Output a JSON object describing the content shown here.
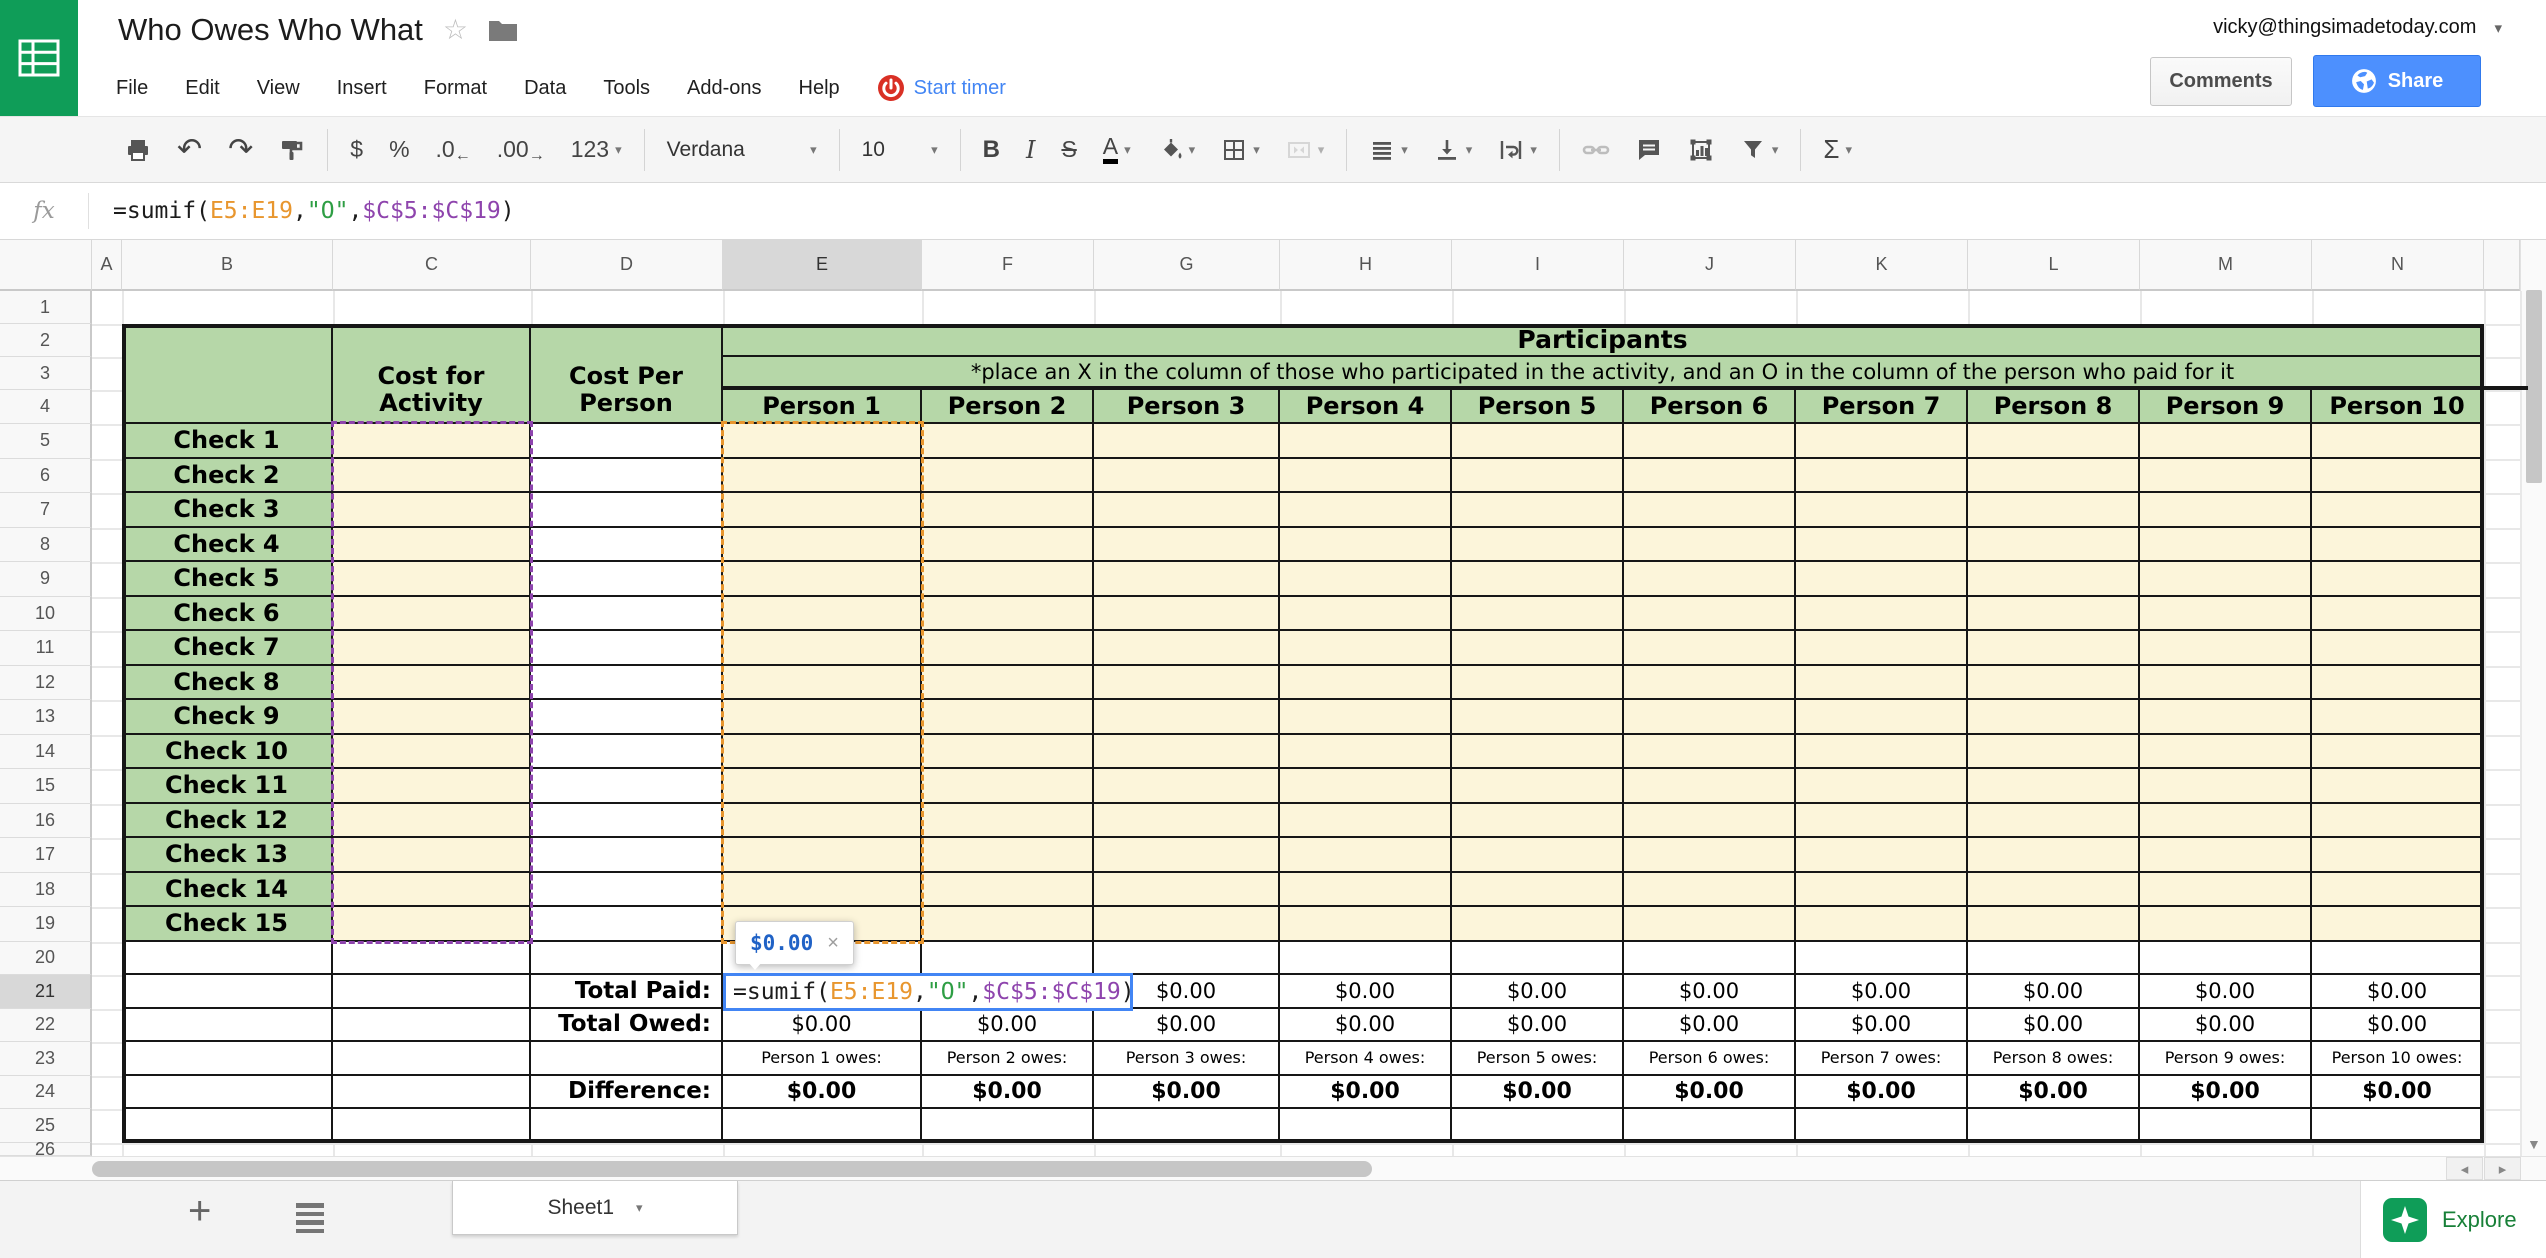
{
  "titlebar": {
    "title": "Who Owes Who What",
    "account_email": "vicky@thingsimadetoday.com",
    "comments_label": "Comments",
    "share_label": "Share"
  },
  "menubar": {
    "items": [
      "File",
      "Edit",
      "View",
      "Insert",
      "Format",
      "Data",
      "Tools",
      "Add-ons",
      "Help"
    ],
    "timer_label": "Start timer"
  },
  "toolbar": {
    "currency": "$",
    "percent": "%",
    "decrease_decimal": ".0",
    "increase_decimal": ".00",
    "more_formats": "123",
    "font_name": "Verdana",
    "font_size": "10",
    "bold": "B",
    "italic": "I",
    "strikethrough": "S",
    "text_color": "A",
    "functions": "Σ"
  },
  "formula_bar": {
    "fx_label": "fx",
    "formula": [
      {
        "text": "=sumif(",
        "color": "#1c1c1c"
      },
      {
        "text": "E5:E19",
        "color": "#e8962e"
      },
      {
        "text": ",",
        "color": "#1c1c1c"
      },
      {
        "text": "\"O\"",
        "color": "#2e9e44"
      },
      {
        "text": ",",
        "color": "#1c1c1c"
      },
      {
        "text": "$C$5:$C$19",
        "color": "#8e44ad"
      },
      {
        "text": ")",
        "color": "#1c1c1c"
      }
    ]
  },
  "sheet": {
    "column_letters": [
      "A",
      "B",
      "C",
      "D",
      "E",
      "F",
      "G",
      "H",
      "I",
      "J",
      "K",
      "L",
      "M",
      "N"
    ],
    "row_numbers": [
      "1",
      "2",
      "3",
      "4",
      "5",
      "6",
      "7",
      "8",
      "9",
      "10",
      "11",
      "12",
      "13",
      "14",
      "15",
      "16",
      "17",
      "18",
      "19",
      "20",
      "21",
      "22",
      "23",
      "24",
      "25",
      "26"
    ],
    "cost_for_activity": "Cost for Activity",
    "cost_per_person": "Cost Per Person",
    "participants_title": "Participants",
    "participants_note": "*place an X in the column of those who participated in the activity, and an O in the column of the person who paid for it",
    "person_headers": [
      "Person 1",
      "Person 2",
      "Person 3",
      "Person 4",
      "Person 5",
      "Person 6",
      "Person 7",
      "Person 8",
      "Person 9",
      "Person 10"
    ],
    "check_labels": [
      "Check 1",
      "Check 2",
      "Check 3",
      "Check 4",
      "Check 5",
      "Check 6",
      "Check 7",
      "Check 8",
      "Check 9",
      "Check 10",
      "Check 11",
      "Check 12",
      "Check 13",
      "Check 14",
      "Check 15"
    ],
    "total_paid_label": "Total Paid:",
    "total_owed_label": "Total Owed:",
    "difference_label": "Difference:",
    "total_paid_values": [
      "$0.00",
      "$0.00",
      "$0.00",
      "$0.00",
      "$0.00",
      "$0.00",
      "$0.00",
      "$0.00"
    ],
    "total_owed_values": [
      "$0.00",
      "$0.00",
      "$0.00",
      "$0.00",
      "$0.00",
      "$0.00",
      "$0.00",
      "$0.00",
      "$0.00",
      "$0.00"
    ],
    "owes_labels": [
      "Person 1 owes:",
      "Person 2 owes:",
      "Person 3 owes:",
      "Person 4 owes:",
      "Person 5 owes:",
      "Person 6 owes:",
      "Person 7 owes:",
      "Person 8 owes:",
      "Person 9 owes:",
      "Person 10 owes:"
    ],
    "difference_values": [
      "$0.00",
      "$0.00",
      "$0.00",
      "$0.00",
      "$0.00",
      "$0.00",
      "$0.00",
      "$0.00",
      "$0.00",
      "$0.00"
    ],
    "active_cell": {
      "tooltip_value": "$0.00"
    }
  },
  "bottombar": {
    "add_sheet": "+",
    "sheet_tab": "Sheet1",
    "explore_label": "Explore"
  },
  "colors": {
    "logo_green": "#0f9d58",
    "header_green": "#b6d7a8",
    "cell_yellow": "#fcf5da",
    "share_blue": "#4d90fe",
    "timer_blue": "#4285f4",
    "explore_green": "#188038",
    "range_orange": "#e8962e",
    "range_purple": "#8e44ad",
    "edit_border_blue": "#4285f4"
  }
}
